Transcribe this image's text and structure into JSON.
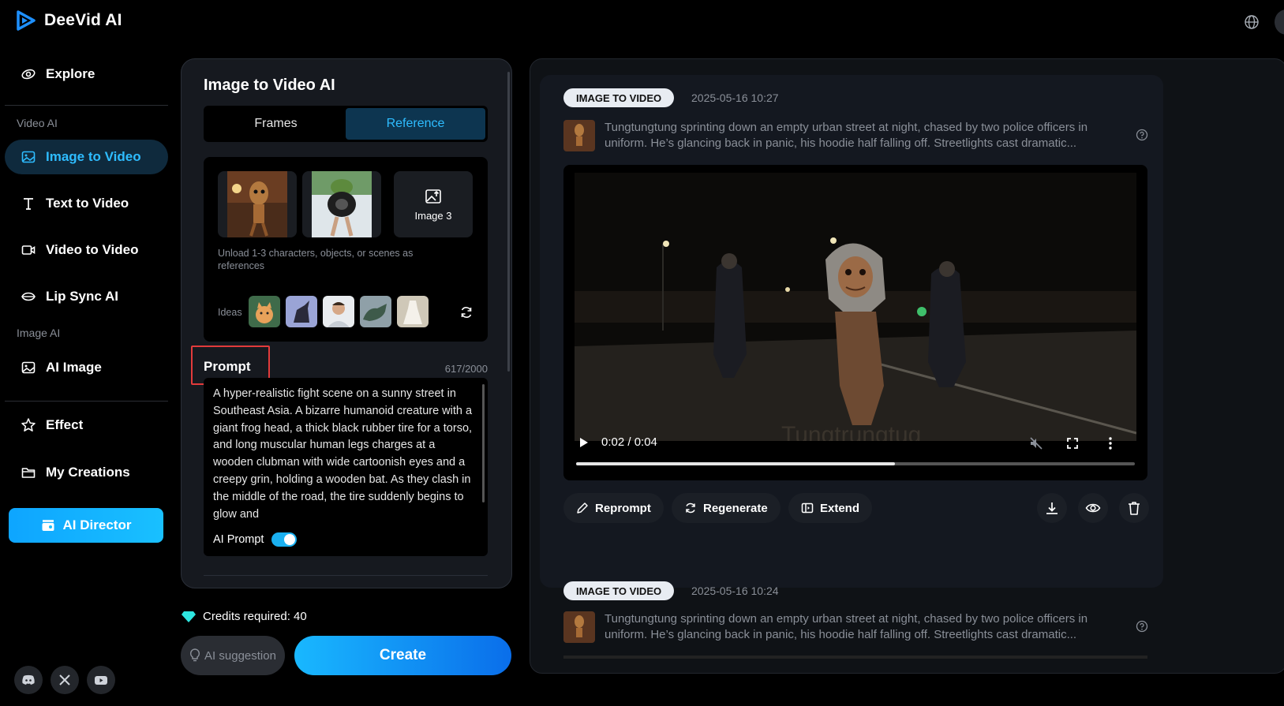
{
  "app": {
    "name": "DeeVid AI"
  },
  "sidebar": {
    "explore": "Explore",
    "section_video": "Video AI",
    "section_image": "Image AI",
    "items": [
      {
        "label": "Image to Video",
        "icon": "image-icon"
      },
      {
        "label": "Text to Video",
        "icon": "text-icon"
      },
      {
        "label": "Video to Video",
        "icon": "video-icon"
      },
      {
        "label": "Lip Sync AI",
        "icon": "lips-icon"
      },
      {
        "label": "AI Image",
        "icon": "ai-image-icon"
      },
      {
        "label": "Effect",
        "icon": "star-icon"
      },
      {
        "label": "My Creations",
        "icon": "folder-icon"
      }
    ],
    "ai_director": "AI Director",
    "social": [
      "discord-icon",
      "x-icon",
      "youtube-icon"
    ]
  },
  "editor": {
    "title": "Image to Video AI",
    "tabs": [
      {
        "label": "Frames",
        "active": false
      },
      {
        "label": "Reference",
        "active": true
      }
    ],
    "upload_label": "Image 3",
    "hint": "Unload 1-3 characters, objects, or scenes as references",
    "ideas_label": "Ideas",
    "prompt_label": "Prompt",
    "prompt_count": "617/2000",
    "prompt_text": "A hyper-realistic fight scene on a sunny street in Southeast Asia. A bizarre humanoid creature with a giant frog head, a thick black rubber tire for a torso, and long muscular human legs charges at a wooden clubman with wide cartoonish eyes and a creepy grin, holding a wooden bat. As they clash in the middle of the road, the tire suddenly begins to glow and",
    "ai_prompt_label": "AI Prompt",
    "ai_prompt_on": true,
    "credits": "Credits required: 40",
    "ai_suggestion": "AI suggestion",
    "create": "Create"
  },
  "results": [
    {
      "badge": "IMAGE TO VIDEO",
      "timestamp": "2025-05-16 10:27",
      "caption": "Tungtungtung sprinting down an empty urban street at night, chased by two police officers in uniform. He’s glancing back in panic, his hoodie half falling off. Streetlights cast dramatic...",
      "video": {
        "time": "0:02 / 0:04",
        "progress": 0.57,
        "watermark": "Tungtrungtug"
      },
      "actions": [
        "Reprompt",
        "Regenerate",
        "Extend"
      ],
      "icon_actions": [
        "download-icon",
        "eye-icon",
        "trash-icon"
      ]
    },
    {
      "badge": "IMAGE TO VIDEO",
      "timestamp": "2025-05-16 10:24",
      "caption": "Tungtungtung sprinting down an empty urban street at night, chased by two police officers in uniform. He’s glancing back in panic, his hoodie half falling off. Streetlights cast dramatic..."
    }
  ],
  "colors": {
    "accent": "#2ebcff",
    "create_start": "#19b8ff",
    "create_end": "#0a6eea",
    "highlight": "#e23b3b"
  }
}
